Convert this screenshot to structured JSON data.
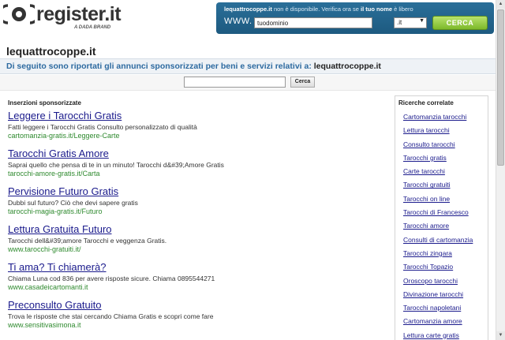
{
  "logo": {
    "text": "register.it",
    "subtext": "A DADA BRAND"
  },
  "domain_check": {
    "domain": "lequattrocoppe.it",
    "msg_not_available": "non è disponibile. Verifica ora se",
    "msg_own_name": "il tuo nome",
    "msg_free": "è libero",
    "www_label": "WWW.",
    "input_value": "tuodominio",
    "tld_value": ".it",
    "button_label": "CERCA"
  },
  "page": {
    "title": "lequattrocoppe.it",
    "subtitle_text": "Di seguito sono riportati gli annunci sponsorizzati per beni e servizi relativi a:",
    "subtitle_domain": "lequattrocoppe.it"
  },
  "search": {
    "input_value": "",
    "button_label": "Cerca"
  },
  "ads": {
    "heading": "Inserzioni sponsorizzate",
    "items": [
      {
        "title": "Leggere i Tarocchi Gratis",
        "desc": "Fatti leggere i Tarocchi Gratis Consulto personalizzato di qualità",
        "url": "cartomanzia-gratis.it/Leggere-Carte"
      },
      {
        "title": "Tarocchi Gratis Amore",
        "desc": "Saprai quello che pensa di te in un minuto! Tarocchi d&#39;Amore Gratis",
        "url": "tarocchi-amore-gratis.it/Carta"
      },
      {
        "title": "Pervisione Futuro Gratis",
        "desc": "Dubbi sul futuro? Ciò che devi sapere gratis",
        "url": "tarocchi-magia-gratis.it/Futuro"
      },
      {
        "title": "Lettura Gratuita Futuro",
        "desc": "Tarocchi dell&#39;amore Tarocchi e veggenza Gratis.",
        "url": "www.tarocchi-gratuiti.it/"
      },
      {
        "title": "Ti ama? Ti chiamerà?",
        "desc": "Chiama Luna cod 836 per avere risposte sicure. Chiama 0895544271",
        "url": "www.casadeicartomanti.it"
      },
      {
        "title": "Preconsulto Gratuito",
        "desc": "Trova le risposte che stai cercando Chiama Gratis e scopri come fare",
        "url": "www.sensitivasimona.it"
      }
    ]
  },
  "related": {
    "heading": "Ricerche correlate",
    "items": [
      "Cartomanzia tarocchi",
      "Lettura tarocchi",
      "Consulto tarocchi",
      "Tarocchi gratis",
      "Carte tarocchi",
      "Tarocchi gratuiti",
      "Tarocchi on line",
      "Tarocchi di Francesco",
      "Tarocchi amore",
      "Consulti di cartomanzia",
      "Tarocchi zingara",
      "Tarocchi Topazio",
      "Oroscopo tarocchi",
      "Divinazione tarocchi",
      "Tarocchi napoletani",
      "Cartomanzia amore",
      "Lettura carte gratis"
    ]
  }
}
